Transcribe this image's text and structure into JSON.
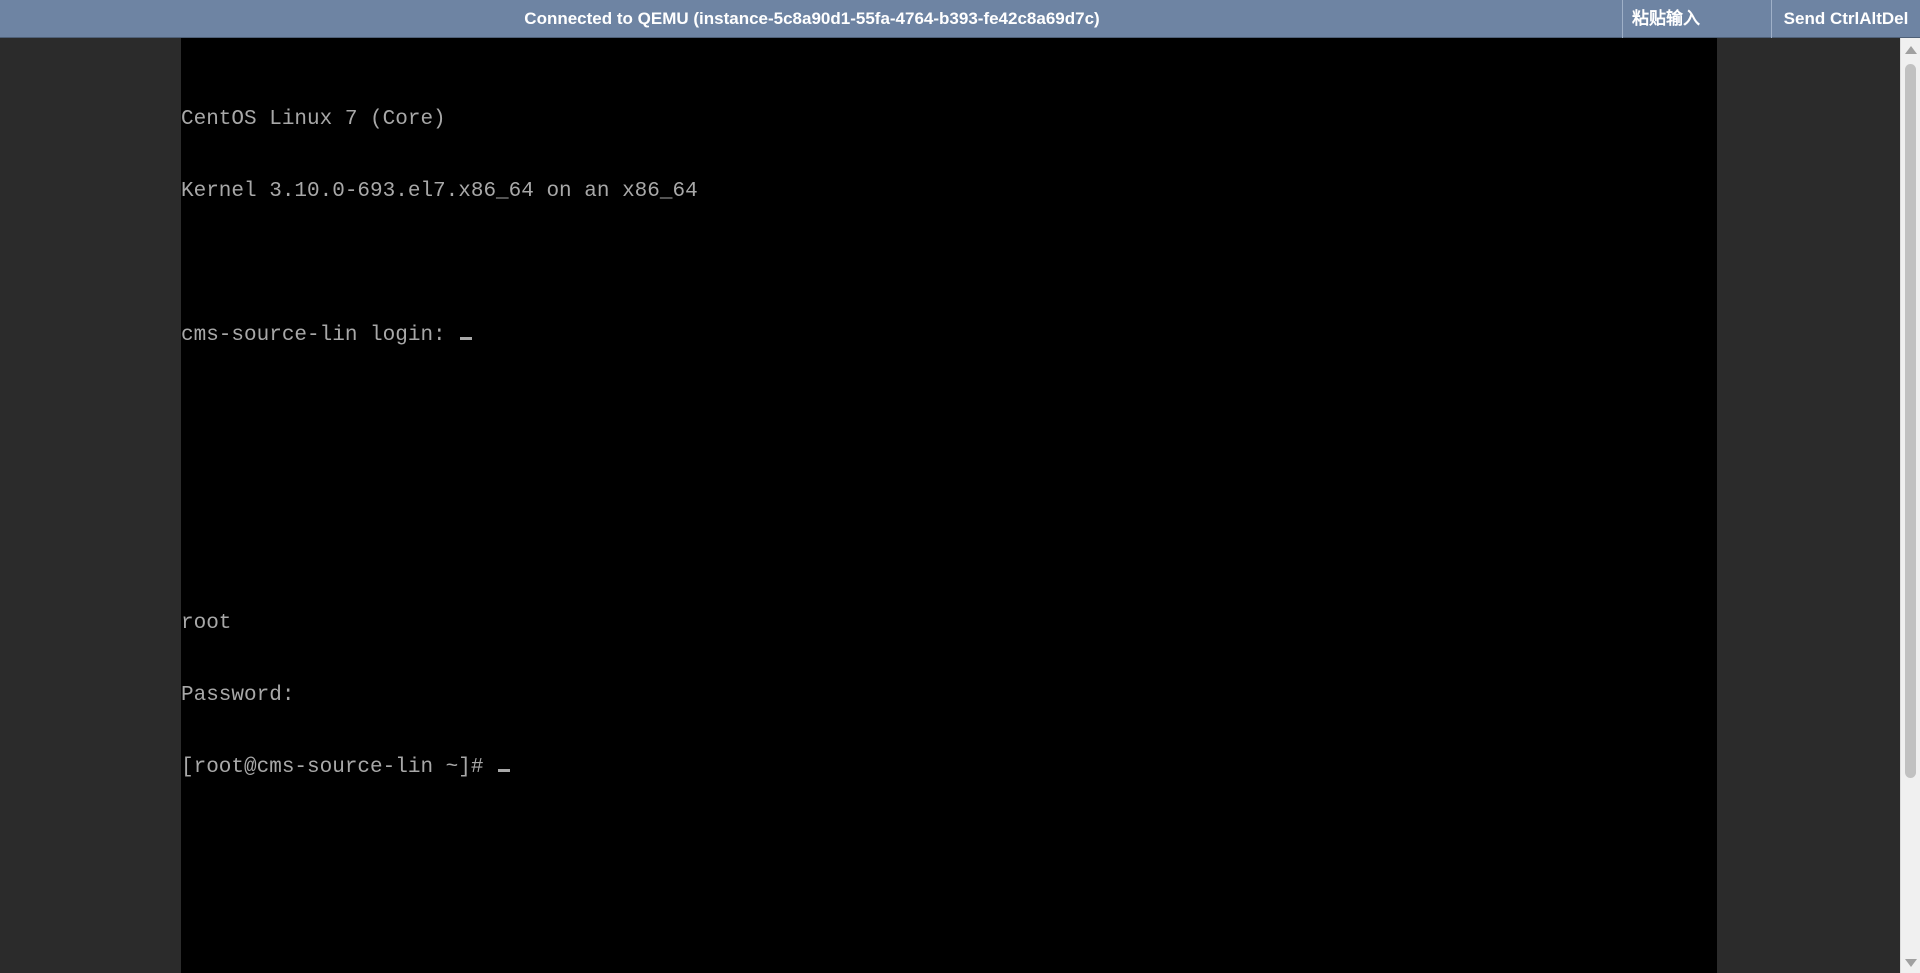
{
  "topbar": {
    "status_text": "Connected to QEMU (instance-5c8a90d1-55fa-4764-b393-fe42c8a69d7c)",
    "paste_button": "粘贴输入",
    "ctrlaltdel_button": "Send CtrlAltDel",
    "background_color": "#6e84a3"
  },
  "console": {
    "lines": [
      "CentOS Linux 7 (Core)",
      "Kernel 3.10.0-693.el7.x86_64 on an x86_64",
      "",
      "cms-source-lin login: ",
      "",
      "",
      "",
      "root",
      "Password:",
      "[root@cms-source-lin ~]# "
    ],
    "text_color": "#a8a8a8",
    "background_color": "#000000"
  },
  "scrollbar": {
    "up_icon": "arrow-up-icon",
    "down_icon": "arrow-down-icon"
  }
}
